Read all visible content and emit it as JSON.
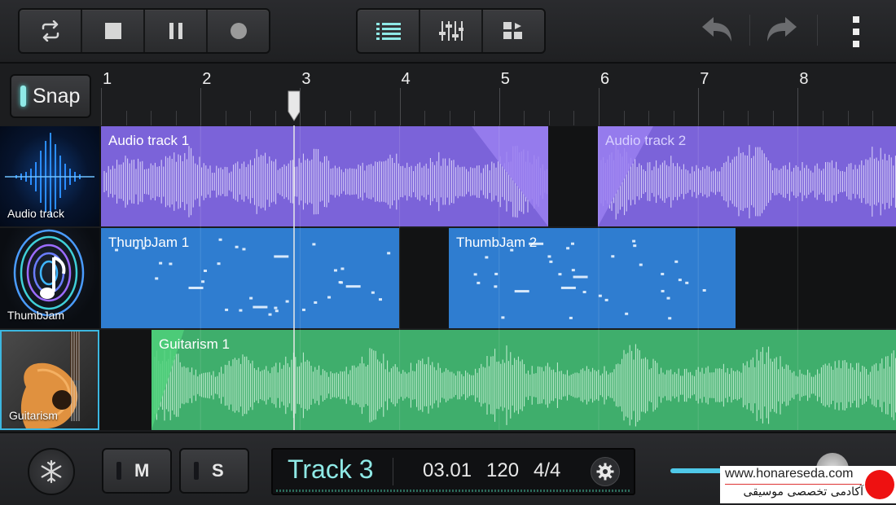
{
  "toolbar": {
    "transport": [
      "loop-icon",
      "stop-icon",
      "pause-icon",
      "record-icon"
    ],
    "views": [
      "track-list-icon",
      "mixer-icon",
      "grid-view-icon"
    ],
    "undo_icon": "undo-icon",
    "redo_icon": "redo-icon",
    "menu_icon": "overflow-menu-icon"
  },
  "ruler": {
    "snap_label": "Snap",
    "bars": [
      "1",
      "2",
      "3",
      "4",
      "5",
      "6",
      "7",
      "8"
    ]
  },
  "tracks": [
    {
      "name": "Audio track",
      "color": "#7a62d8",
      "clips": [
        {
          "title": "Audio track 1"
        },
        {
          "title": "Audio track 2"
        }
      ]
    },
    {
      "name": "ThumbJam",
      "color": "#2f7fd0",
      "clips": [
        {
          "title": "ThumbJam 1"
        },
        {
          "title": "ThumbJam 2"
        }
      ]
    },
    {
      "name": "Guitarism",
      "color": "#3eaf6c",
      "clips": [
        {
          "title": "Guitarism 1"
        }
      ]
    }
  ],
  "bottom": {
    "freeze_icon": "snowflake-icon",
    "mute_label": "M",
    "solo_label": "S",
    "track_label": "Track 3",
    "position": "03.01",
    "tempo": "120",
    "time_signature": "4/4",
    "settings_icon": "gear-icon"
  },
  "watermark": {
    "url": "www.honareseda.com",
    "subtitle": "آکادمی تخصصی موسیقی"
  }
}
